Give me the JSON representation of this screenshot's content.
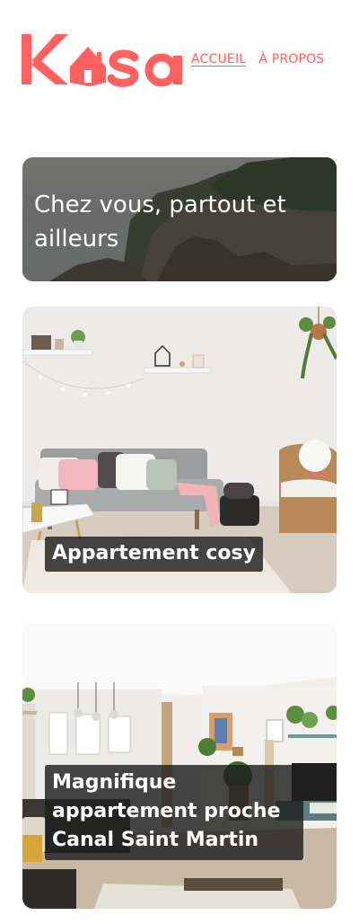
{
  "brand": {
    "logo_text": "Kasa",
    "color": "#FF6060"
  },
  "nav": [
    {
      "label": "ACCUEIL",
      "active": true
    },
    {
      "label": "À PROPOS",
      "active": false
    }
  ],
  "banner": {
    "title": "Chez vous, partout et ailleurs"
  },
  "listings": [
    {
      "title": "Appartement cosy"
    },
    {
      "title": "Magnifique appartement proche Canal Saint Martin"
    }
  ]
}
